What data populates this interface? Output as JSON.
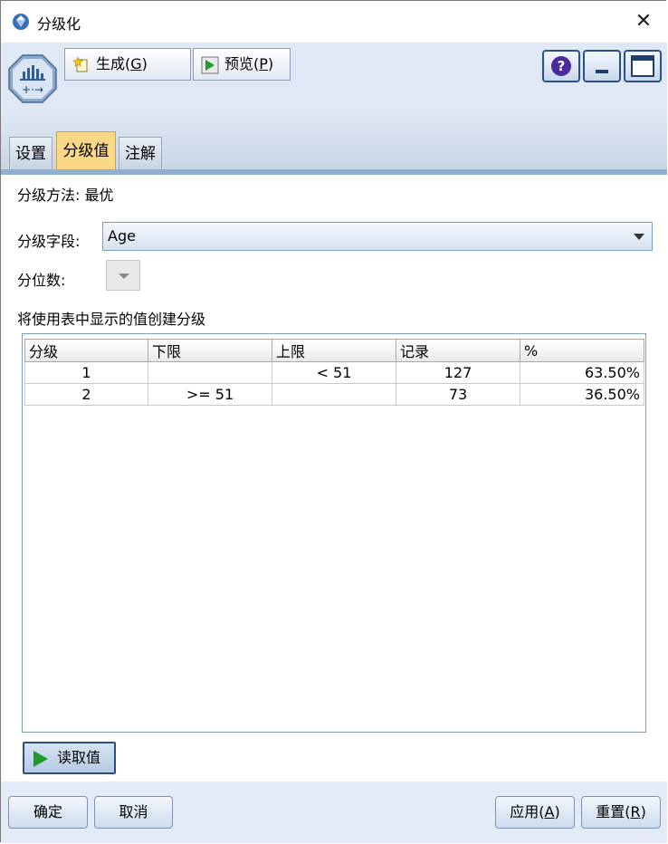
{
  "window": {
    "title": "分级化",
    "close_glyph": "✕"
  },
  "toolbar": {
    "generate_label": "生成(",
    "generate_key": "G",
    "generate_close": ")",
    "preview_label": "预览(",
    "preview_key": "P",
    "preview_close": ")",
    "help_glyph": "?",
    "icons": [
      "node-binning-icon",
      "generate-star-icon",
      "preview-play-icon",
      "help-icon",
      "minimize-icon",
      "maximize-icon"
    ]
  },
  "tabs": [
    {
      "label": "设置",
      "active": false
    },
    {
      "label": "分级值",
      "active": true
    },
    {
      "label": "注解",
      "active": false
    }
  ],
  "main": {
    "method_text": "分级方法: 最优",
    "field_label": "分级字段:",
    "field_value": "Age",
    "tiles_label": "分位数:",
    "info_text": "将使用表中显示的值创建分级"
  },
  "table": {
    "columns": [
      "分级",
      "下限",
      "上限",
      "记录",
      "%"
    ],
    "rows": [
      {
        "bin": "1",
        "lower": "",
        "upper": "< 51",
        "records": "127",
        "percent": "63.50%"
      },
      {
        "bin": "2",
        "lower": ">= 51",
        "upper": "",
        "records": "73",
        "percent": "36.50%"
      }
    ]
  },
  "read_values_label": "读取值",
  "footer": {
    "ok_label": "确定",
    "cancel_label": "取消",
    "apply_label": "应用(",
    "apply_key": "A",
    "apply_close": ")",
    "reset_label": "重置(",
    "reset_key": "R",
    "reset_close": ")"
  },
  "colors": {
    "active_tab": "#fcd886",
    "toolbar_bg": "#dfe9f5",
    "tab_rule": "#8fb0d3",
    "play_green": "#1f9a2c",
    "help_purple": "#4b2a9a"
  }
}
